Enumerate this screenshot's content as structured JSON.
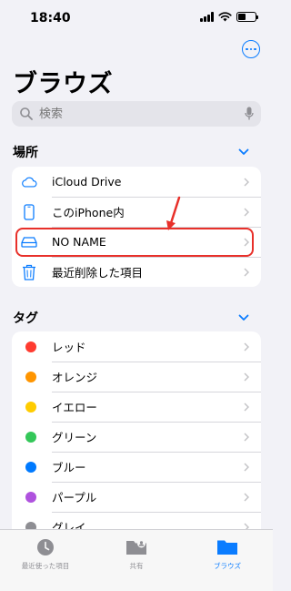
{
  "status": {
    "time": "18:40"
  },
  "title": "ブラウズ",
  "search": {
    "placeholder": "検索"
  },
  "locations": {
    "header": "場所",
    "items": [
      {
        "label": "iCloud Drive",
        "icon": "cloud-icon"
      },
      {
        "label": "このiPhone内",
        "icon": "iphone-icon"
      },
      {
        "label": "NO NAME",
        "icon": "external-drive-icon"
      },
      {
        "label": "最近削除した項目",
        "icon": "trash-icon"
      }
    ]
  },
  "tags": {
    "header": "タグ",
    "items": [
      {
        "label": "レッド",
        "color": "#ff3b30"
      },
      {
        "label": "オレンジ",
        "color": "#ff9500"
      },
      {
        "label": "イエロー",
        "color": "#ffcc00"
      },
      {
        "label": "グリーン",
        "color": "#34c759"
      },
      {
        "label": "ブルー",
        "color": "#007aff"
      },
      {
        "label": "パープル",
        "color": "#af52de"
      },
      {
        "label": "グレイ",
        "color": "#8e8e93"
      }
    ]
  },
  "tabbar": {
    "tabs": [
      {
        "label": "最近使った項目",
        "icon": "clock-icon",
        "active": false
      },
      {
        "label": "共有",
        "icon": "shared-folder-icon",
        "active": false
      },
      {
        "label": "ブラウズ",
        "icon": "folder-icon",
        "active": true
      }
    ]
  },
  "colors": {
    "accent": "#0a7cff",
    "highlight": "#e8302a"
  }
}
